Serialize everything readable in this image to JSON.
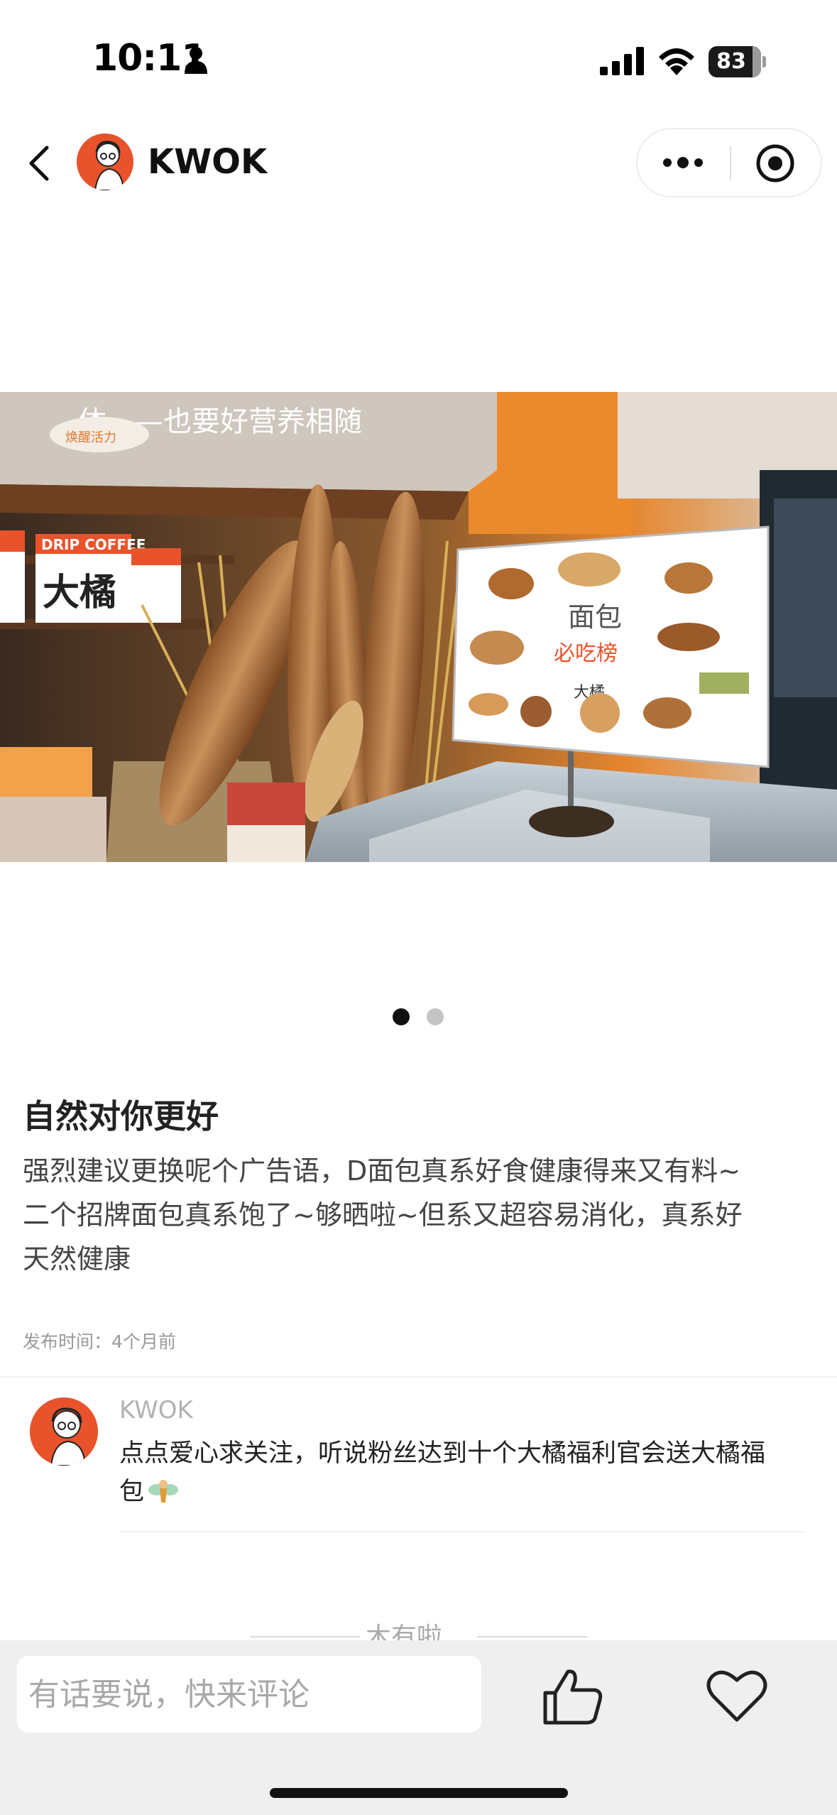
{
  "status_bar": {
    "time": "10:11",
    "battery_level": "83",
    "icons": [
      "person-icon",
      "signal-icon",
      "wifi-icon",
      "battery-icon"
    ]
  },
  "nav": {
    "title": "KWOK",
    "icons": [
      "back-arrow-icon",
      "avatar",
      "more-dots-icon",
      "close-target-icon"
    ]
  },
  "photo": {
    "carousel_pages": 2,
    "current_page": 1,
    "signs": {
      "coffee_box_label": "DRIP COFFEE",
      "brand_sign": "大橘",
      "menu_title": "面包",
      "menu_subtitle": "必吃榜",
      "menu_footer": "大橘",
      "banner_text": "体——也要好营养相随",
      "banner_tag": "焕醒活力"
    }
  },
  "post": {
    "title": "自然对你更好",
    "body_lines": [
      "强烈建议更换呢个广告语，D面包真系好食健康得来又有料~",
      "二个招牌面包真系饱了~够晒啦~但系又超容易消化，真系好",
      "天然健康"
    ],
    "time": "发布时间：4个月前"
  },
  "comment": {
    "author": "KWOK",
    "text_line1": "点点爱心求关注，听说粉丝达到十个大橘福利官会送大橘福",
    "text_line2": "包"
  },
  "end_marker": "木有啦",
  "bottom_bar": {
    "input_placeholder": "有话要说，快来评论",
    "icons": [
      "thumbs-up-icon",
      "heart-icon"
    ]
  },
  "colors": {
    "brand_orange": "#e8532b",
    "bottom_bar_bg": "#efefef"
  }
}
